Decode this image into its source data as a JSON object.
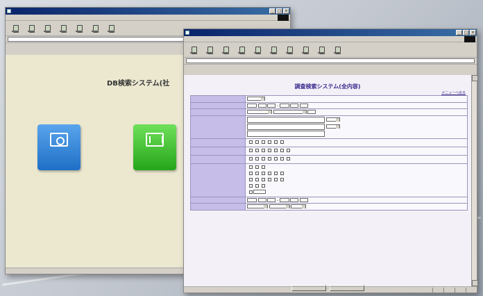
{
  "back_window": {
    "page_heading": "DB検索システム(社"
  },
  "front_window": {
    "page_heading": "調査検索システム(全内容)",
    "menu_link": "メニューへ戻る"
  },
  "colors": {
    "titlebar": "#0a246a",
    "form_label_bg": "#c6bee9",
    "search_button": "#1e6fc6",
    "record_button": "#25a51a",
    "heading_text": "#3b2c8e"
  },
  "icons": {
    "toolbar": [
      "back-icon",
      "forward-icon",
      "stop-icon",
      "refresh-icon",
      "home-icon",
      "search-icon",
      "favorites-icon",
      "history-icon",
      "mail-icon",
      "print-icon"
    ]
  }
}
